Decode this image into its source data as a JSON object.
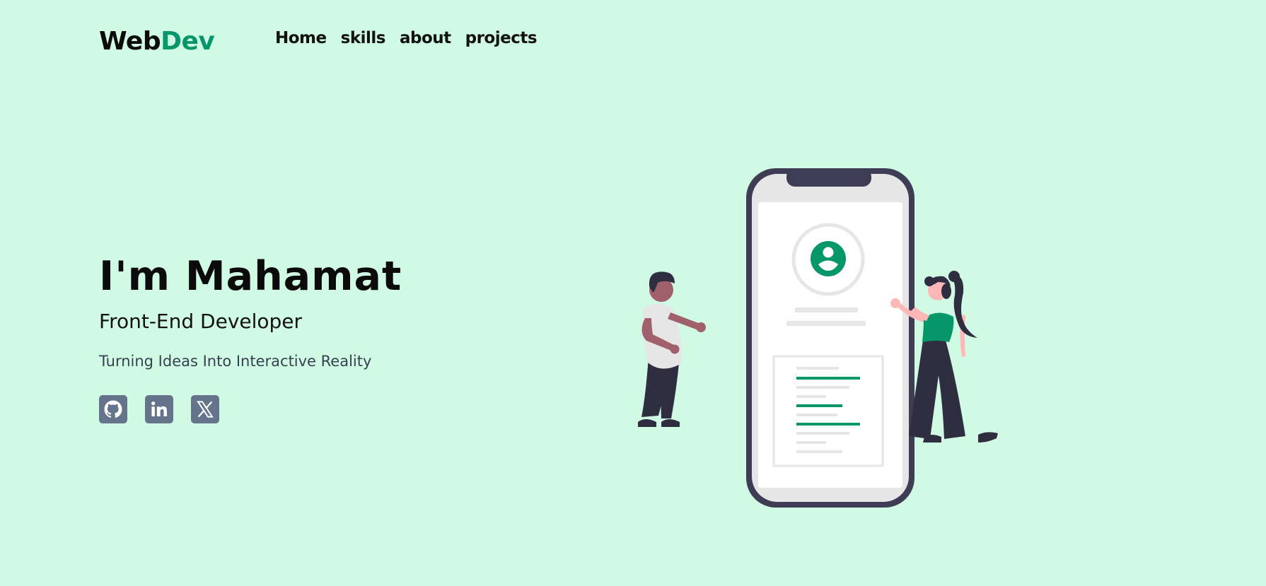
{
  "brand": {
    "part1": "Web",
    "part2": "Dev"
  },
  "nav": [
    {
      "label": "Home"
    },
    {
      "label": "skills"
    },
    {
      "label": "about"
    },
    {
      "label": "projects"
    }
  ],
  "hero": {
    "title": "I'm Mahamat",
    "role": "Front-End Developer",
    "tagline": "Turning Ideas Into Interactive Reality"
  },
  "socials": [
    {
      "icon": "github-icon"
    },
    {
      "icon": "linkedin-icon"
    },
    {
      "icon": "x-twitter-icon"
    }
  ],
  "colors": {
    "background": "#d1fae5",
    "accent": "#059669",
    "icon_bg": "#64748b"
  }
}
